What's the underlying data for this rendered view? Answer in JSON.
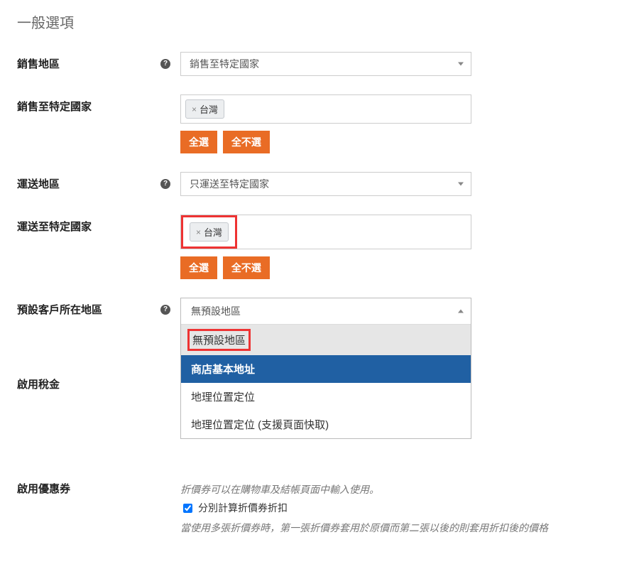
{
  "section_title": "一般選項",
  "rows": {
    "selling_locations": {
      "label": "銷售地區",
      "value": "銷售至特定國家"
    },
    "sell_to_countries": {
      "label": "銷售至特定國家",
      "chip": "台灣",
      "select_all": "全選",
      "select_none": "全不選"
    },
    "shipping_locations": {
      "label": "運送地區",
      "value": "只運送至特定國家"
    },
    "ship_to_countries": {
      "label": "運送至特定國家",
      "chip": "台灣",
      "select_all": "全選",
      "select_none": "全不選"
    },
    "default_location": {
      "label": "預設客戶所在地區",
      "value": "無預設地區",
      "options": {
        "o1": "無預設地區",
        "o2": "商店基本地址",
        "o3": "地理位置定位",
        "o4": "地理位置定位 (支援頁面快取)"
      }
    },
    "enable_tax": {
      "label": "啟用稅金"
    },
    "enable_coupon": {
      "label": "啟用優惠券",
      "help1": "折價券可以在購物車及結帳頁面中輸入使用。",
      "cb_label": "分別計算折價券折扣",
      "help2": "當使用多張折價券時，第一張折價券套用於原價而第二張以後的則套用折扣後的價格"
    }
  }
}
